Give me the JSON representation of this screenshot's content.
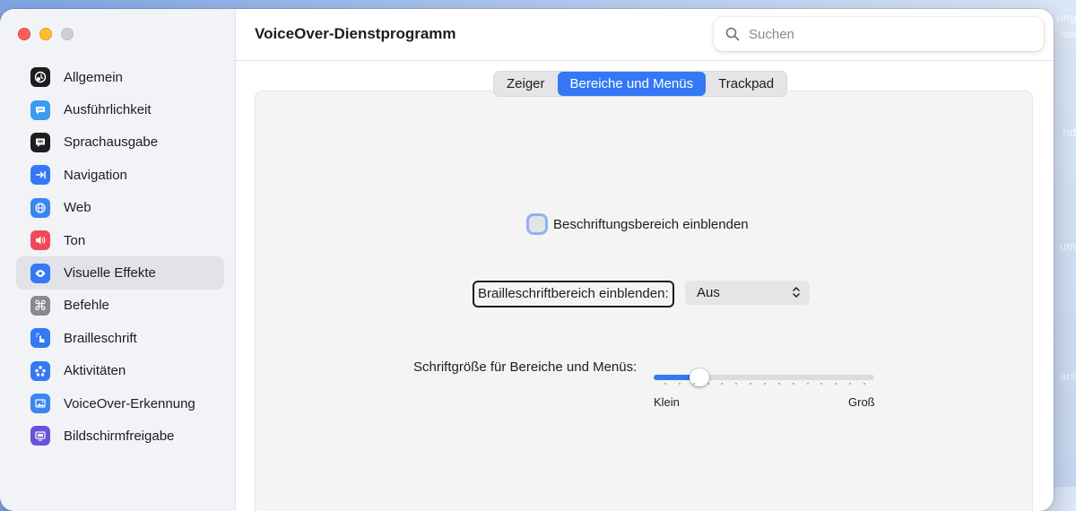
{
  "desktop": {
    "labels": [
      "ung",
      "ias",
      "nd",
      "um",
      "ars"
    ]
  },
  "sidebar": {
    "items": [
      {
        "label": "Allgemein",
        "icon": "general-icon",
        "color": "#1d1d1f"
      },
      {
        "label": "Ausführlichkeit",
        "icon": "speech-bubble-icon",
        "color": "#3a9bf3"
      },
      {
        "label": "Sprachausgabe",
        "icon": "speech-icon",
        "color": "#1d1d1f"
      },
      {
        "label": "Navigation",
        "icon": "navigation-arrow-icon",
        "color": "#3478f6"
      },
      {
        "label": "Web",
        "icon": "globe-icon",
        "color": "#3a86ef"
      },
      {
        "label": "Ton",
        "icon": "speaker-icon",
        "color": "#ef4a5a"
      },
      {
        "label": "Visuelle Effekte",
        "icon": "eye-icon",
        "color": "#3478f6"
      },
      {
        "label": "Befehle",
        "icon": "command-icon",
        "color": "#8a8a8e"
      },
      {
        "label": "Brailleschrift",
        "icon": "braille-hand-icon",
        "color": "#3478f6"
      },
      {
        "label": "Aktivitäten",
        "icon": "activities-icon",
        "color": "#3478f6"
      },
      {
        "label": "VoiceOver-Erkennung",
        "icon": "image-recognition-icon",
        "color": "#3a86ef"
      },
      {
        "label": "Bildschirmfreigabe",
        "icon": "screen-sharing-icon",
        "color": "#6b52d6"
      }
    ],
    "selected_index": 6
  },
  "header": {
    "title": "VoiceOver-Dienstprogramm"
  },
  "search": {
    "placeholder": "Suchen"
  },
  "tabs": [
    {
      "label": "Zeiger",
      "active": false
    },
    {
      "label": "Bereiche und Menüs",
      "active": true
    },
    {
      "label": "Trackpad",
      "active": false
    }
  ],
  "content": {
    "caption_checkbox_label": "Beschriftungsbereich einblenden",
    "caption_checkbox_checked": false,
    "braille_label": "Brailleschriftbereich einblenden:",
    "braille_select_value": "Aus",
    "font_size_label": "Schriftgröße für Bereiche und Menüs:",
    "font_size_min": "Klein",
    "font_size_max": "Groß",
    "font_size_value": 0.18
  },
  "colors": {
    "accent": "#3478f6"
  }
}
